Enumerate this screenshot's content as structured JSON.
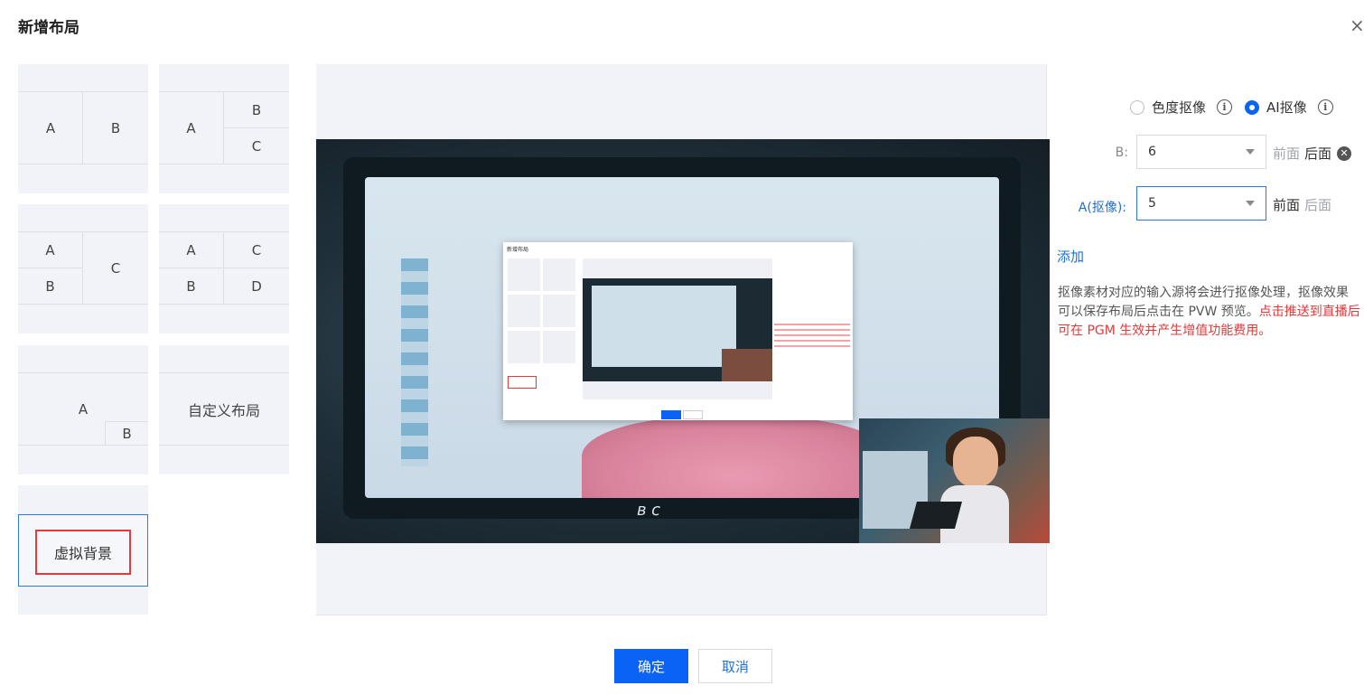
{
  "dialog": {
    "title": "新增布局",
    "close_glyph": "×"
  },
  "layouts": {
    "ab": {
      "a": "A",
      "b": "B"
    },
    "abc": {
      "a": "A",
      "b": "B",
      "c": "C"
    },
    "abc_left": {
      "a": "A",
      "b": "B",
      "c": "C"
    },
    "abcd": {
      "a": "A",
      "b": "B",
      "c": "C",
      "d": "D"
    },
    "pip": {
      "a": "A",
      "b": "B"
    },
    "custom_label": "自定义布局",
    "virtual_bg_label": "虚拟背景"
  },
  "preview": {
    "mini_title": "新增布局"
  },
  "panel": {
    "mode_chroma": "色度抠像",
    "mode_ai": "AI抠像",
    "info_glyph": "i",
    "selected_mode": "ai",
    "b_label": "B:",
    "b_value": "6",
    "a_label": "A(抠像):",
    "a_value": "5",
    "front": "前面",
    "back": "后面",
    "remove_glyph": "✕",
    "add_link": "添加",
    "note_normal": "抠像素材对应的输入源将会进行抠像处理，抠像效果可以保存布局后点击在 PVW 预览。",
    "note_warn": "点击推送到直播后可在 PGM 生效并产生增值功能费用。"
  },
  "footer": {
    "confirm": "确定",
    "cancel": "取消"
  },
  "colors": {
    "primary": "#0a63f5",
    "link": "#1f6fd6",
    "warning": "#e03a3a",
    "selected_border": "#2b7bd6"
  }
}
